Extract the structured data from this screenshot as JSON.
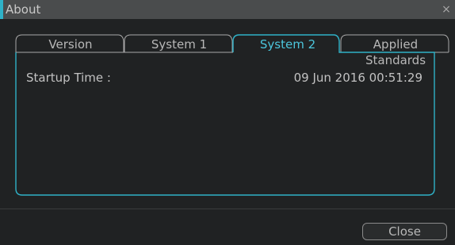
{
  "dialog": {
    "title": "About",
    "close_glyph": "×"
  },
  "tabs": [
    {
      "label": "Version",
      "active": false
    },
    {
      "label": "System 1",
      "active": false
    },
    {
      "label": "System 2",
      "active": true
    },
    {
      "label": "Applied Standards",
      "active": false
    }
  ],
  "panel": {
    "startup_label": "Startup Time :",
    "startup_value": "09 Jun 2016 00:51:29"
  },
  "footer": {
    "close_label": "Close"
  },
  "colors": {
    "accent": "#4cc6dc",
    "titlebar": "#4a4c4d",
    "background": "#202223"
  },
  "icons": {
    "close": "close-icon"
  }
}
